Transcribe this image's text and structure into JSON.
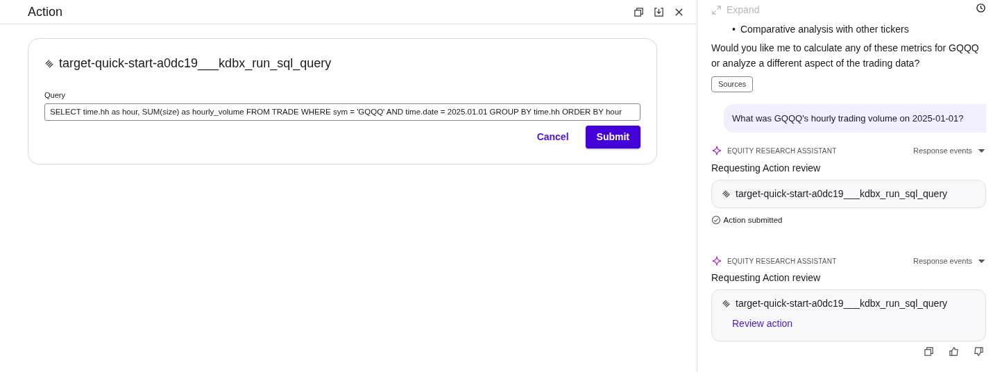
{
  "action_panel": {
    "title": "Action",
    "tool_name": "target-quick-start-a0dc19___kdbx_run_sql_query",
    "query": {
      "label": "Query",
      "value": "SELECT time.hh as hour, SUM(size) as hourly_volume FROM TRADE WHERE sym = 'GQQQ' AND time.date = 2025.01.01 GROUP BY time.hh ORDER BY hour"
    },
    "buttons": [
      {
        "label": "Cancel",
        "kind": "link"
      },
      {
        "label": "Submit",
        "kind": "primary"
      }
    ]
  },
  "chat_panel": {
    "expand": {
      "label": "Expand",
      "disabled": true
    },
    "messages": [
      {
        "kind": "assistant_text",
        "bullets": [
          {
            "marker": "•",
            "text": "Comparative analysis with other tickers"
          }
        ],
        "paragraph": "Would you like me to calculate any of these metrics for GQQQ or analyze a different aspect of the trading data?",
        "sources_label": "Sources"
      },
      {
        "kind": "user",
        "text": "What was GQQQ's hourly trading volume on 2025-01-01?"
      },
      {
        "kind": "assistant_action",
        "sender": "EQUITY RESEARCH ASSISTANT",
        "events_label": "Response events",
        "status": "Requesting Action review",
        "tool_name": "target-quick-start-a0dc19___kdbx_run_sql_query",
        "submitted": true,
        "submitted_label": "Action submitted"
      },
      {
        "kind": "assistant_action",
        "sender": "EQUITY RESEARCH ASSISTANT",
        "events_label": "Response events",
        "status": "Requesting Action review",
        "tool_name": "target-quick-start-a0dc19___kdbx_run_sql_query",
        "submitted": false,
        "review_label": "Review action"
      }
    ]
  }
}
